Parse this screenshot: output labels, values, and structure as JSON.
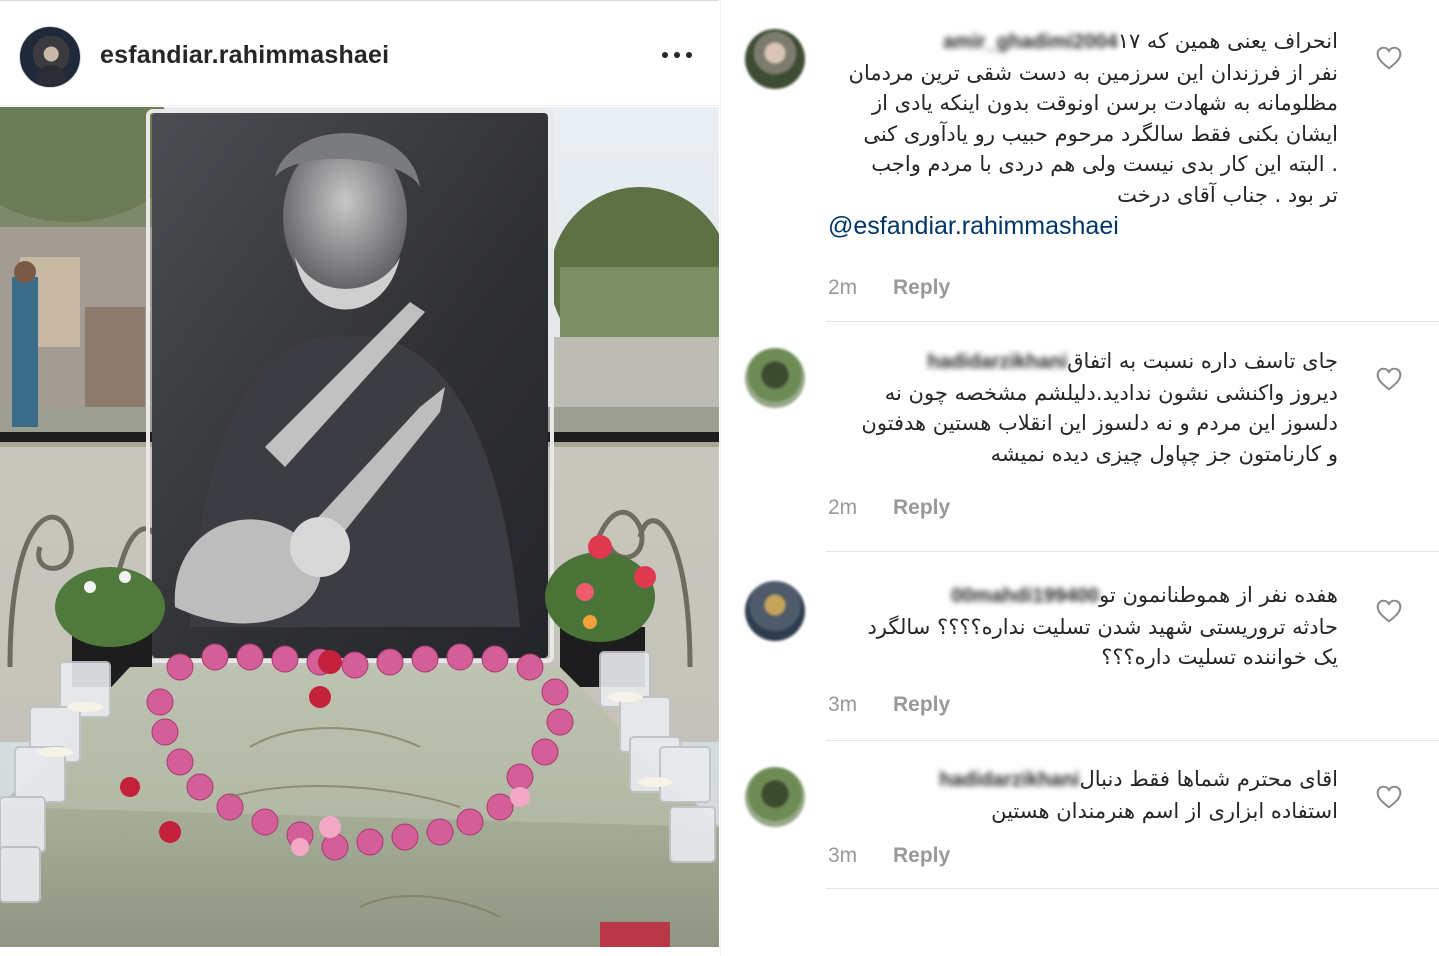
{
  "post": {
    "username": "esfandiar.rahimmashaei",
    "more_icon": "more-horizontal-icon"
  },
  "comments": [
    {
      "username": "amir_ghadimi2004",
      "lines": [
        "انحراف یعنی همین که ۱۷",
        "نفر از فرزندان این سرزمین به دست شقی ترین مردمان",
        "مظلومانه به شهادت برسن اونوقت بدون اینکه یادی از",
        "ایشان بکنی فقط سالگرد مرحوم حبیب رو یادآوری کنی",
        ". البته این کار بدی نیست ولی هم دردی با مردم واجب",
        "تر بود . جناب آقای درخت"
      ],
      "mention": "@esfandiar.rahimmashaei",
      "time": "2m",
      "reply": "Reply"
    },
    {
      "username": "hadidarzikhani",
      "lines": [
        "جای تاسف داره نسبت به اتفاق",
        "دیروز واکنشی نشون ندادید.دلیلشم مشخصه چون نه",
        "دلسوز این مردم و نه دلسوز این انقلاب هستین هدفتون",
        "و کارنامتون جز چپاول چیزی دیده نمیشه"
      ],
      "time": "2m",
      "reply": "Reply"
    },
    {
      "username": "00mahdi199400",
      "lines": [
        "هفده نفر از هموطنانمون تو",
        "حادثه تروریستی شهید شدن تسلیت نداره؟؟؟؟ سالگرد",
        "یک خواننده تسلیت داره؟؟؟"
      ],
      "time": "3m",
      "reply": "Reply"
    },
    {
      "username": "hadidarzikhani",
      "lines": [
        "اقای محترم شماها فقط دنبال",
        "استفاده ابزاری از اسم هنرمندان هستین"
      ],
      "time": "3m",
      "reply": "Reply"
    }
  ],
  "icons": {
    "like": "heart-outline-icon"
  },
  "colors": {
    "text": "#262626",
    "meta": "#999999",
    "mention": "#003569",
    "separator": "#e6e6e6"
  }
}
